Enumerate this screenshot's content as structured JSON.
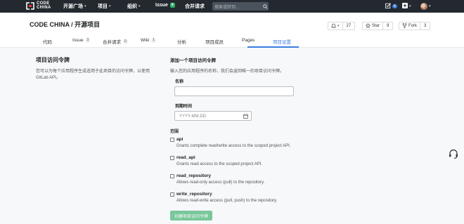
{
  "nav": {
    "logo_line1": "CODE",
    "logo_line2": "CHINA",
    "items": [
      {
        "label": "开源广场",
        "caret": "▾"
      },
      {
        "label": "项目",
        "caret": "▾"
      },
      {
        "label": "组织",
        "caret": "▾"
      },
      {
        "label": "Issue",
        "badge": "6"
      },
      {
        "label": "合并请求"
      }
    ],
    "search_placeholder": "搜索或转到...",
    "todo_count": "6",
    "plus_caret": "▾",
    "avatar_caret": "▾"
  },
  "header": {
    "title": "CODE CHINA / 开源项目",
    "notify_caret": "▾",
    "notify_count": "27",
    "star_label": "Star",
    "star_count": "9",
    "fork_label": "Fork",
    "fork_count": "3"
  },
  "tabs": [
    {
      "label": "代码"
    },
    {
      "label": "Issue",
      "count": "3"
    },
    {
      "label": "合并请求",
      "count": "0"
    },
    {
      "label": "Wiki",
      "count": "1"
    },
    {
      "label": "分析"
    },
    {
      "label": "项目成员"
    },
    {
      "label": "Pages"
    },
    {
      "label": "项目设置"
    }
  ],
  "left": {
    "title": "项目访问令牌",
    "desc_line1": "您可以为每个应用程序生成适用于此项目的访问令牌，以使用",
    "desc_line2": "GitLab API。"
  },
  "form": {
    "heading": "添加一个项目访问令牌",
    "subheading": "输入您的应用程序的名称，我们会返回唯一的项目访问令牌。",
    "name_label": "名称",
    "name_value": "",
    "expires_label": "到期时间",
    "expires_placeholder": "YYYY-MM-DD",
    "scopes_label": "范围",
    "scopes": [
      {
        "name": "api",
        "desc": "Grants complete read/write access to the scoped project API."
      },
      {
        "name": "read_api",
        "desc": "Grants read access to the scoped project API."
      },
      {
        "name": "read_repository",
        "desc": "Allows read-only access (pull) to the repository."
      },
      {
        "name": "write_repository",
        "desc": "Allows read-write access (pull, push) to the repository."
      }
    ],
    "submit_label": "创建项目访问令牌"
  },
  "colors": {
    "nav_bg": "#23292f",
    "accent": "#3b7de0",
    "submit_bg": "#79c79a",
    "badge_green": "#2fae66"
  }
}
